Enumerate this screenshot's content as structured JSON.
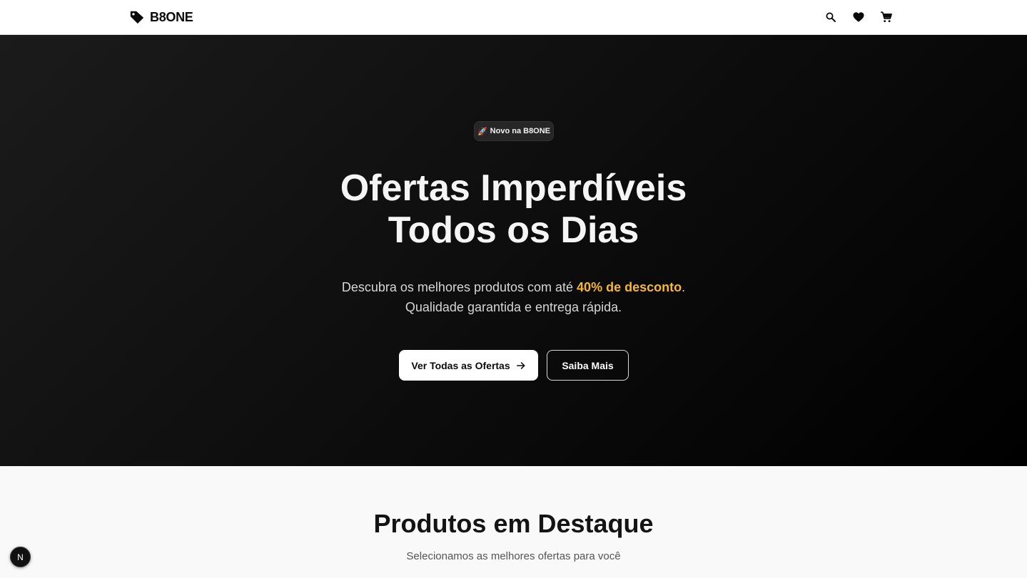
{
  "navbar": {
    "brand_name": "B8ONE",
    "icons": [
      "tag-icon",
      "search-icon",
      "heart-icon",
      "cart-icon"
    ]
  },
  "hero": {
    "badge_emoji": "🚀",
    "badge_text": "Novo na B8ONE",
    "title_line1": "Ofertas Imperdíveis",
    "title_line2": "Todos os Dias",
    "subtitle_before": "Descubra os melhores produtos com até ",
    "subtitle_highlight": "40% de desconto",
    "subtitle_after": ".",
    "subtitle_line2": "Qualidade garantida e entrega rápida.",
    "primary_button": "Ver Todas as Ofertas",
    "primary_button_icon": "arrow-right-icon",
    "secondary_button": "Saiba Mais"
  },
  "featured": {
    "title": "Produtos em Destaque",
    "subtitle": "Selecionamos as melhores ofertas para você"
  },
  "dev_badge": {
    "label": "N"
  },
  "colors": {
    "highlight": "#f5b82e",
    "hero_bg": "#0c0c0c",
    "nav_bg": "#ffffff"
  }
}
